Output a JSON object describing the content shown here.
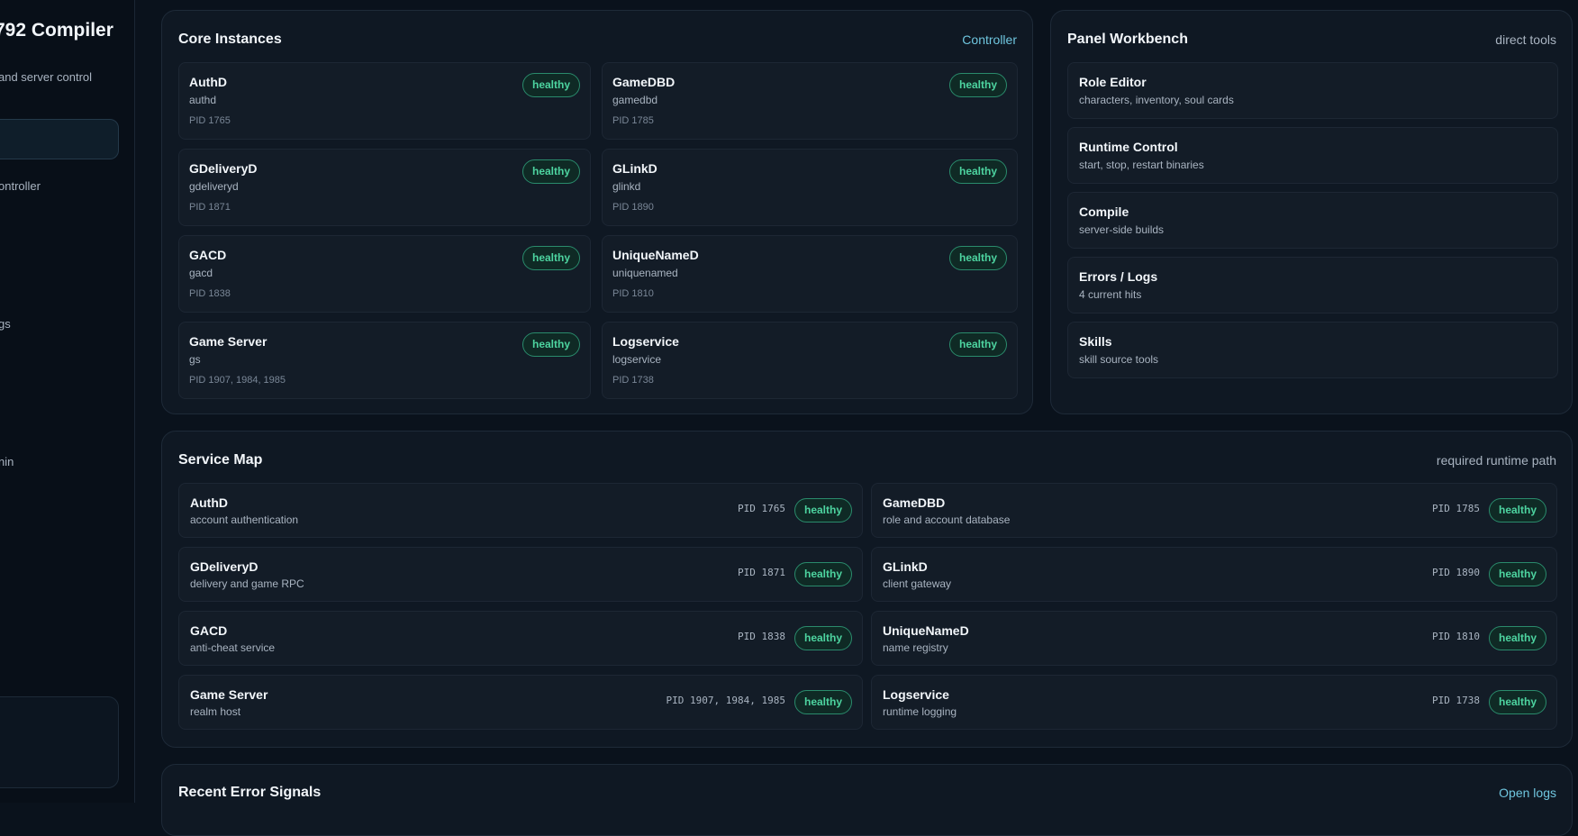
{
  "sidebar": {
    "title": "792 Compiler",
    "subtitle": "and server control",
    "items": [
      {
        "label": "ontroller"
      },
      {
        "label": "gs"
      },
      {
        "label": "nin"
      }
    ]
  },
  "core_instances": {
    "title": "Core Instances",
    "link": "Controller",
    "items": [
      {
        "name": "AuthD",
        "key": "authd",
        "pid": "PID 1765",
        "status": "healthy"
      },
      {
        "name": "GameDBD",
        "key": "gamedbd",
        "pid": "PID 1785",
        "status": "healthy"
      },
      {
        "name": "GDeliveryD",
        "key": "gdeliveryd",
        "pid": "PID 1871",
        "status": "healthy"
      },
      {
        "name": "GLinkD",
        "key": "glinkd",
        "pid": "PID 1890",
        "status": "healthy"
      },
      {
        "name": "GACD",
        "key": "gacd",
        "pid": "PID 1838",
        "status": "healthy"
      },
      {
        "name": "UniqueNameD",
        "key": "uniquenamed",
        "pid": "PID 1810",
        "status": "healthy"
      },
      {
        "name": "Game Server",
        "key": "gs",
        "pid": "PID 1907, 1984, 1985",
        "status": "healthy"
      },
      {
        "name": "Logservice",
        "key": "logservice",
        "pid": "PID 1738",
        "status": "healthy"
      }
    ]
  },
  "workbench": {
    "title": "Panel Workbench",
    "right": "direct tools",
    "items": [
      {
        "title": "Role Editor",
        "sub": "characters, inventory, soul cards"
      },
      {
        "title": "Runtime Control",
        "sub": "start, stop, restart binaries"
      },
      {
        "title": "Compile",
        "sub": "server-side builds"
      },
      {
        "title": "Errors / Logs",
        "sub": "4 current hits"
      },
      {
        "title": "Skills",
        "sub": "skill source tools"
      }
    ]
  },
  "service_map": {
    "title": "Service Map",
    "right": "required runtime path",
    "items": [
      {
        "name": "AuthD",
        "desc": "account authentication",
        "pid": "PID 1765",
        "status": "healthy"
      },
      {
        "name": "GameDBD",
        "desc": "role and account database",
        "pid": "PID 1785",
        "status": "healthy"
      },
      {
        "name": "GDeliveryD",
        "desc": "delivery and game RPC",
        "pid": "PID 1871",
        "status": "healthy"
      },
      {
        "name": "GLinkD",
        "desc": "client gateway",
        "pid": "PID 1890",
        "status": "healthy"
      },
      {
        "name": "GACD",
        "desc": "anti-cheat service",
        "pid": "PID 1838",
        "status": "healthy"
      },
      {
        "name": "UniqueNameD",
        "desc": "name registry",
        "pid": "PID 1810",
        "status": "healthy"
      },
      {
        "name": "Game Server",
        "desc": "realm host",
        "pid": "PID 1907, 1984, 1985",
        "status": "healthy"
      },
      {
        "name": "Logservice",
        "desc": "runtime logging",
        "pid": "PID 1738",
        "status": "healthy"
      }
    ]
  },
  "recent_errors": {
    "title": "Recent Error Signals",
    "link": "Open logs"
  }
}
